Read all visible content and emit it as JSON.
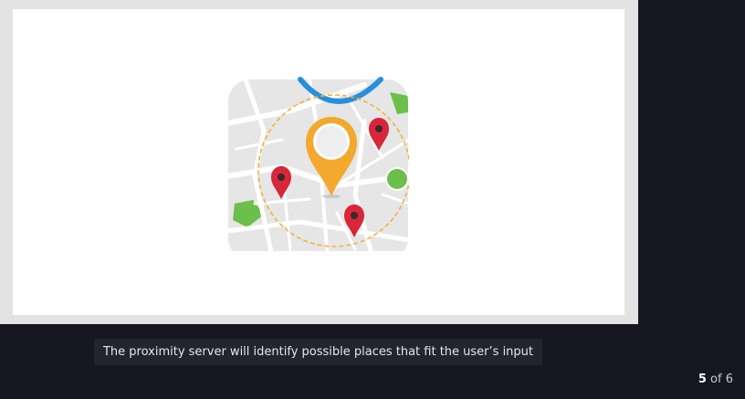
{
  "slide": {
    "caption": "The proximity server will identify possible places that fit the user’s input",
    "current": "5",
    "separator": "of",
    "total": "6"
  },
  "illustration": {
    "icon": "location-map-icon",
    "colors": {
      "map_tile": "#e6e6e6",
      "roads": "#ffffff",
      "main_pin": "#f2a92e",
      "small_pins": "#d8263a",
      "route": "#2a8fdb",
      "parks": "#6cbf4a",
      "radius_ring": "#f0b23a"
    }
  }
}
